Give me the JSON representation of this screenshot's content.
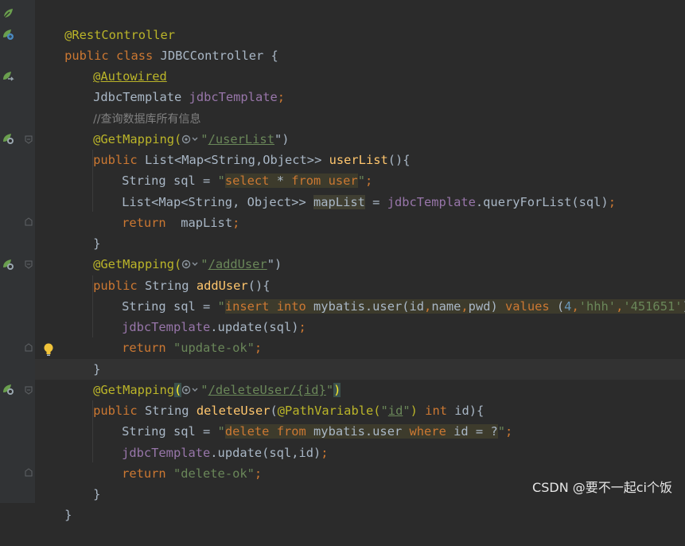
{
  "code": {
    "l1_ann": "@RestController",
    "l2_kw": "public class ",
    "l2_name": "JDBCController {",
    "l3_ann": "@Autowired",
    "l4_type": "JdbcTemplate ",
    "l4_field": "jdbcTemplate",
    "l4_semi": ";",
    "l5_comment": "//查询数据库所有信息",
    "l6_ann": "@GetMapping(",
    "l6_q": "\"",
    "l6_path": "/userList",
    "l6_end": "\")",
    "l7_kw": "public ",
    "l7_type": "List<Map<String,Object>> ",
    "l7_method": "userList",
    "l7_end": "(){",
    "l8_decl": "String sql = ",
    "l8_q1": "\"",
    "l8_select": "select",
    "l8_star": " * ",
    "l8_from": "from",
    "l8_sp": " ",
    "l8_user": "user",
    "l8_q2": "\"",
    "l8_semi": ";",
    "l9_type": "List<Map<String, Object>> ",
    "l9_var": "mapList",
    "l9_eq": " = ",
    "l9_field": "jdbcTemplate",
    "l9_call": ".queryForList(sql)",
    "l9_semi": ";",
    "l10_kw": "return",
    "l10_val": "  mapList",
    "l10_semi": ";",
    "l11": "}",
    "l12_ann": "@GetMapping(",
    "l12_q": "\"",
    "l12_path": "/addUser",
    "l12_end": "\")",
    "l13_kw": "public ",
    "l13_type": "String ",
    "l13_method": "addUser",
    "l13_end": "(){",
    "l14_decl": "String sql = ",
    "l14_q1": "\"",
    "l14_insert": "insert into",
    "l14_table": " mybatis.user(id",
    "l14_c1": ",",
    "l14_name": "name",
    "l14_c2": ",",
    "l14_pwd": "pwd)",
    "l14_values": " values ",
    "l14_p": "(",
    "l14_4": "4",
    "l14_c3": ",",
    "l14_hhh": "'hhh'",
    "l14_c4": ",",
    "l14_pw": "'451651'",
    "l14_cp": ")",
    "l14_q2": "\"",
    "l14_semi": ";",
    "l15_field": "jdbcTemplate",
    "l15_call": ".update(sql)",
    "l15_semi": ";",
    "l16_kw": "return ",
    "l16_str": "\"update-ok\"",
    "l16_semi": ";",
    "l17": "}",
    "l18_ann": "@GetMapping",
    "l18_p": "(",
    "l18_q": "\"",
    "l18_path": "/deleteUser/{id}",
    "l18_q2": "\"",
    "l18_cp": ")",
    "l19_kw": "public ",
    "l19_type": "String ",
    "l19_method": "deleteUser",
    "l19_p": "(",
    "l19_ann": "@PathVariable(",
    "l19_q": "\"",
    "l19_id": "id",
    "l19_q2": "\"",
    "l19_cp": ")",
    "l19_int": " int ",
    "l19_end": "id){",
    "l20_decl": "String sql = ",
    "l20_q1": "\"",
    "l20_delete": "delete from",
    "l20_table": " mybatis.user ",
    "l20_where": "where",
    "l20_id": " id = ?",
    "l20_q2": "\"",
    "l20_semi": ";",
    "l21_field": "jdbcTemplate",
    "l21_call": ".update(sql,id)",
    "l21_semi": ";",
    "l22_kw": "return ",
    "l22_str": "\"delete-ok\"",
    "l22_semi": ";",
    "l23": "}",
    "l24": "}"
  },
  "watermark": "CSDN @要不一起ci个饭",
  "icons": {
    "bean": "spring-bean-icon",
    "web": "web-endpoint-icon",
    "fold": "fold-marker-icon",
    "bulb": "intention-bulb-icon",
    "search": "url-search-icon"
  },
  "colors": {
    "background": "#2b2b2b",
    "keyword": "#cc7832",
    "annotation": "#bbb529",
    "string": "#6a8759",
    "field": "#9876aa",
    "method": "#ffc66d",
    "number": "#6897bb",
    "comment": "#808080",
    "text": "#a9b7c6"
  }
}
